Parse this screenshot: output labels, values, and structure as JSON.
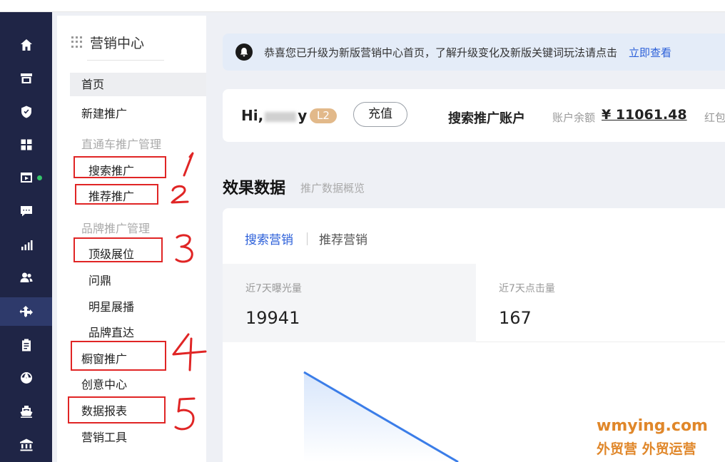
{
  "sidebar_rail": {
    "icons": [
      "home-icon",
      "store-icon",
      "shield-icon",
      "apps-icon",
      "video-icon",
      "message-icon",
      "chart-icon",
      "users-icon",
      "promotion-icon",
      "clipboard-icon",
      "globe-icon",
      "ship-icon",
      "bank-icon"
    ],
    "active_index": 8
  },
  "side_nav": {
    "title": "营销中心",
    "home": "首页",
    "new_promo": "新建推广",
    "group_ztc": "直通车推广管理",
    "search_promo": "搜索推广",
    "recommend_promo": "推荐推广",
    "group_brand": "品牌推广管理",
    "top_showcase": "顶级展位",
    "wending": "问鼎",
    "star_broadcast": "明星展播",
    "brand_direct": "品牌直达",
    "window_promo": "橱窗推广",
    "creative_center": "创意中心",
    "data_report": "数据报表",
    "marketing_tools": "营销工具"
  },
  "annotations": {
    "color": "#e02525",
    "numbers": [
      "1",
      "2",
      "3",
      "4",
      "5"
    ]
  },
  "notice": {
    "text": "恭喜您已升级为新版营销中心首页，了解升级变化及新版关键词玩法请点击",
    "link": "立即查看"
  },
  "account": {
    "greeting_start": "Hi,",
    "greeting_end": "y",
    "level": "L2",
    "recharge": "充值",
    "title": "搜索推广账户",
    "balance_label": "账户余额",
    "balance": "¥ 11061.48",
    "redpack_label": "红包"
  },
  "effect": {
    "title": "效果数据",
    "subtitle": "推广数据概览",
    "tabs": [
      "搜索营销",
      "推荐营销"
    ],
    "active_tab": 0,
    "metrics": [
      {
        "label": "近7天曝光量",
        "value": "19941"
      },
      {
        "label": "近7天点击量",
        "value": "167"
      }
    ]
  },
  "watermark": {
    "line1": "wmying.com",
    "line2": "外贸营 外贸运营"
  },
  "colors": {
    "rail_bg": "#1f2546",
    "accent_blue": "#2b5fd9",
    "badge_gold": "#e2b98a",
    "watermark_orange": "#e0872a"
  }
}
